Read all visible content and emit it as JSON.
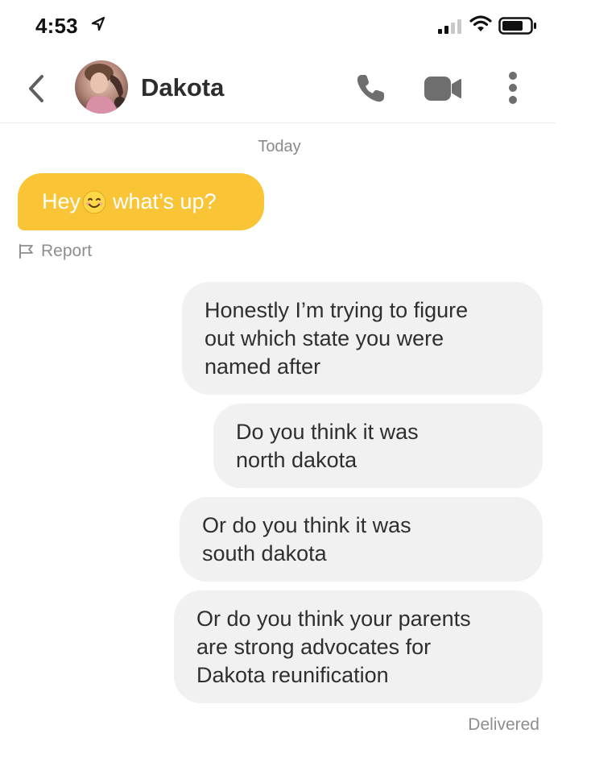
{
  "status_bar": {
    "time": "4:53"
  },
  "header": {
    "contact_name": "Dakota"
  },
  "conversation": {
    "date_label": "Today",
    "incoming": [
      {
        "text_before_emoji": "Hey",
        "emoji": "smiling-face-emoji",
        "text_after_emoji": "what’s up?"
      }
    ],
    "report_label": "Report",
    "outgoing": [
      {
        "lines": [
          "Honestly I’m trying to figure",
          "out which state you were",
          "named after"
        ]
      },
      {
        "lines": [
          "Do you think it was",
          "north dakota"
        ]
      },
      {
        "lines": [
          "Or do you think it was",
          "south dakota"
        ]
      },
      {
        "lines": [
          "Or do you think your parents",
          "are strong advocates for",
          "Dakota reunification"
        ]
      }
    ],
    "delivered_label": "Delivered"
  },
  "colors": {
    "incoming_bubble": "#f9c536",
    "outgoing_bubble": "#f1f1f1",
    "icon_gray": "#6e6e6e"
  },
  "icons": [
    "location-arrow-icon",
    "signal-icon",
    "wifi-icon",
    "battery-icon",
    "back-chevron-icon",
    "phone-icon",
    "video-camera-icon",
    "more-vertical-icon",
    "flag-icon"
  ]
}
